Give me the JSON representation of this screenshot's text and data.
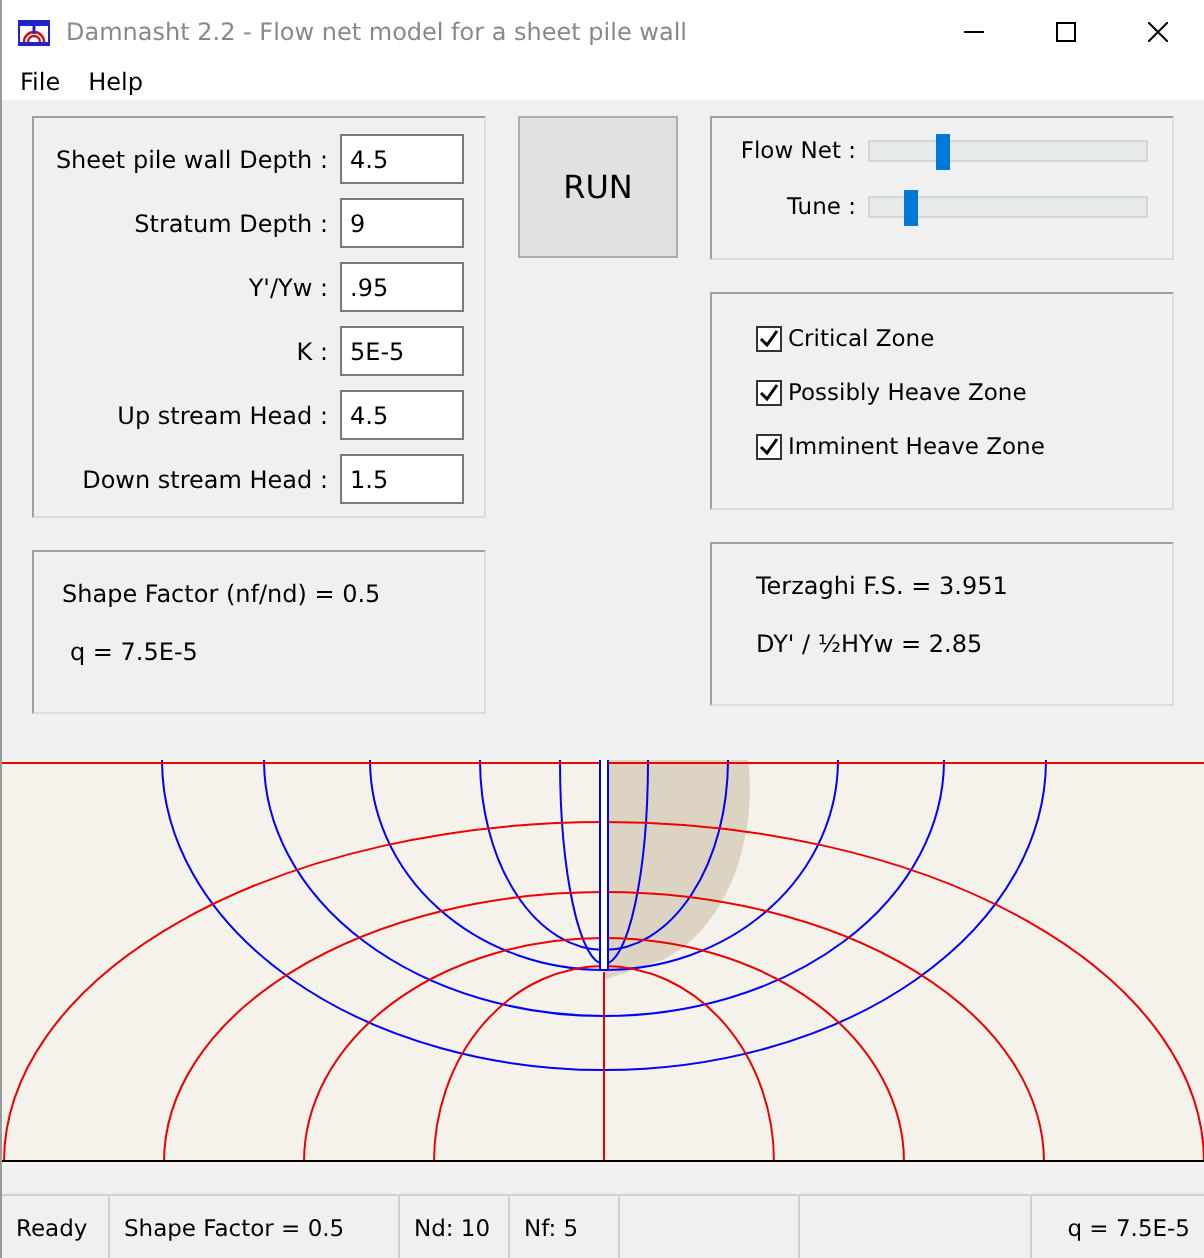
{
  "window": {
    "title": "Damnasht 2.2  -  Flow net model for a sheet pile wall"
  },
  "menu": [
    "File",
    "Help"
  ],
  "inputs": [
    {
      "label": "Sheet pile wall Depth :",
      "value": "4.5"
    },
    {
      "label": "Stratum Depth :",
      "value": "9"
    },
    {
      "label": "Y'/Yw :",
      "value": ".95"
    },
    {
      "label": "K :",
      "value": "5E-5"
    },
    {
      "label": "Up stream Head :",
      "value": "4.5"
    },
    {
      "label": "Down stream Head :",
      "value": "1.5"
    }
  ],
  "run_button": "RUN",
  "sliders": [
    {
      "label": "Flow Net :",
      "level": 0.24
    },
    {
      "label": "Tune :",
      "level": 0.12
    }
  ],
  "checkboxes": [
    {
      "label": "Critical Zone",
      "checked": true
    },
    {
      "label": "Possibly Heave Zone",
      "checked": true
    },
    {
      "label": "Imminent Heave Zone",
      "checked": true
    }
  ],
  "results_left": [
    "Shape Factor (nf/nd) = 0.5",
    "q = 7.5E-5"
  ],
  "results_right": [
    "Terzaghi F.S. = 3.951",
    "DY' / ½HYw = 2.85"
  ],
  "status_bar": [
    "Ready",
    "Shape Factor = 0.5",
    "Nd: 10",
    "Nf: 5",
    "q = 7.5E-5"
  ]
}
